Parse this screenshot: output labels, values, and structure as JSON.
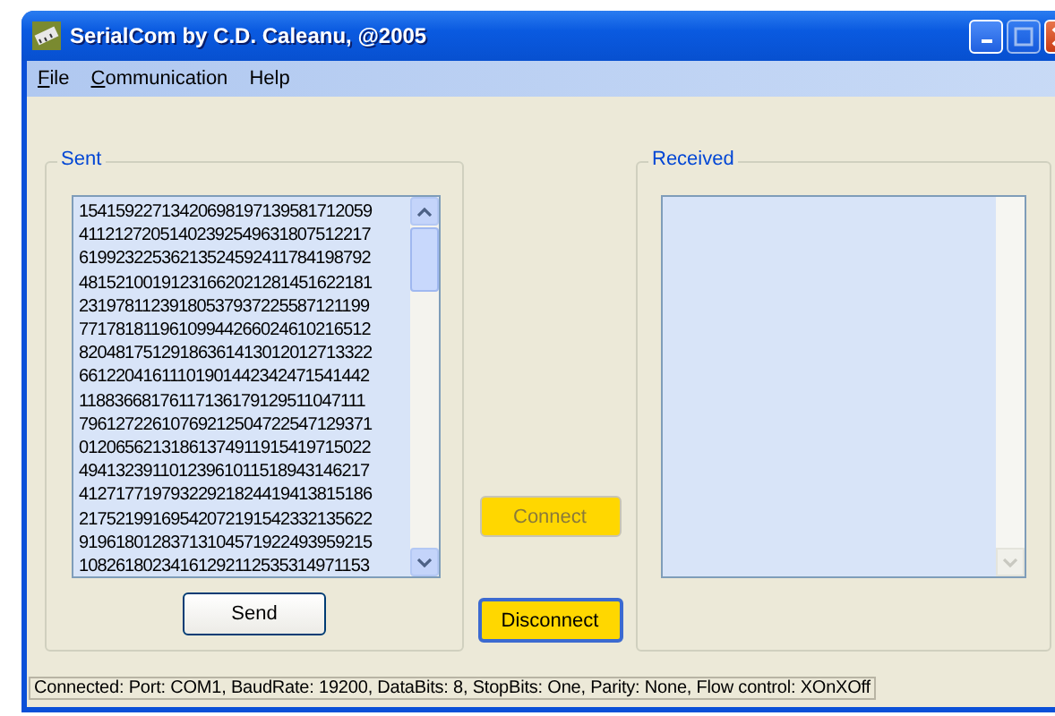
{
  "window": {
    "title": "SerialCom by C.D. Caleanu, @2005"
  },
  "menu": [
    {
      "accel": "F",
      "rest": "ile"
    },
    {
      "accel": "C",
      "rest": "ommunication"
    },
    {
      "label": "Help"
    }
  ],
  "sent": {
    "label": "Sent",
    "lines": [
      "15415922713420698197139581712059",
      "41121272051402392549631807512217",
      "61992322536213524592411784198792",
      "48152100191231662021281451622181",
      "23197811239180537937225587121199",
      "77178181196109944266024610216512",
      "82048175129186361413012012713322",
      "66122041611101901442342471541442",
      "11883668176117136179129511047111",
      "79612722610769212504722547129371",
      "01206562131861374911915419715022",
      "49413239110123961011518943146217",
      "41271771979322921824419413815186",
      "21752199169542072191542332135622",
      "91961801283713104571922493959215",
      "10826180234161292112535314971153"
    ],
    "send_button": "Send"
  },
  "connect_button": {
    "label": "Connect",
    "disabled": true,
    "focused": false
  },
  "disconnect_button": {
    "label": "Disconnect",
    "disabled": false,
    "focused": true
  },
  "received": {
    "label": "Received"
  },
  "status_bar": "Connected: Port: COM1, BaudRate: 19200, DataBits: 8, StopBits: One, Parity: None, Flow control: XOnXOff"
}
